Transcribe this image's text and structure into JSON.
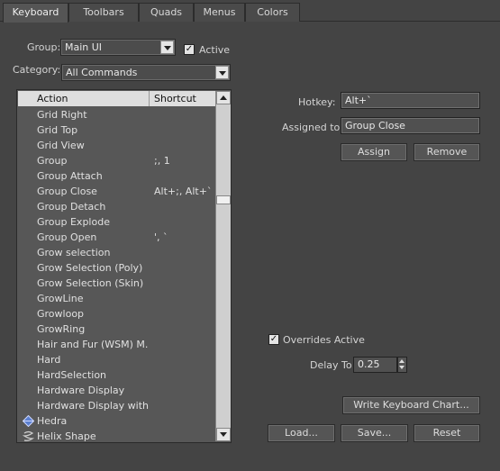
{
  "tabs": [
    {
      "label": "Keyboard",
      "active": true
    },
    {
      "label": "Toolbars",
      "active": false
    },
    {
      "label": "Quads",
      "active": false
    },
    {
      "label": "Menus",
      "active": false
    },
    {
      "label": "Colors",
      "active": false
    }
  ],
  "group": {
    "label": "Group:",
    "value": "Main UI",
    "active_label": "Active",
    "active_checked": true
  },
  "category": {
    "label": "Category:",
    "value": "All Commands"
  },
  "list": {
    "headers": {
      "action": "Action",
      "shortcut": "Shortcut"
    },
    "rows": [
      {
        "action": "Grid Right",
        "shortcut": ""
      },
      {
        "action": "Grid Top",
        "shortcut": ""
      },
      {
        "action": "Grid View",
        "shortcut": ""
      },
      {
        "action": "Group",
        "shortcut": ";, 1"
      },
      {
        "action": "Group Attach",
        "shortcut": ""
      },
      {
        "action": "Group Close",
        "shortcut": "Alt+;, Alt+`"
      },
      {
        "action": "Group Detach",
        "shortcut": ""
      },
      {
        "action": "Group Explode",
        "shortcut": ""
      },
      {
        "action": "Group Open",
        "shortcut": "', `"
      },
      {
        "action": "Grow selection",
        "shortcut": ""
      },
      {
        "action": "Grow Selection (Poly)",
        "shortcut": ""
      },
      {
        "action": "Grow Selection (Skin)",
        "shortcut": ""
      },
      {
        "action": "GrowLine",
        "shortcut": ""
      },
      {
        "action": "Growloop",
        "shortcut": ""
      },
      {
        "action": "GrowRing",
        "shortcut": ""
      },
      {
        "action": "Hair and Fur (WSM) M...",
        "shortcut": ""
      },
      {
        "action": "Hard",
        "shortcut": ""
      },
      {
        "action": "HardSelection",
        "shortcut": ""
      },
      {
        "action": "Hardware Display",
        "shortcut": ""
      },
      {
        "action": "Hardware Display with...",
        "shortcut": ""
      },
      {
        "action": "Hedra",
        "shortcut": "",
        "icon": "hedra-icon"
      },
      {
        "action": "Helix Shape",
        "shortcut": "",
        "icon": "helix-icon"
      }
    ]
  },
  "hotkey": {
    "label": "Hotkey:",
    "value": "Alt+`"
  },
  "assigned": {
    "label": "Assigned to:",
    "value": "Group Close"
  },
  "buttons": {
    "assign": "Assign",
    "remove": "Remove",
    "write_chart": "Write Keyboard Chart...",
    "load": "Load...",
    "save": "Save...",
    "reset": "Reset"
  },
  "overrides": {
    "label": "Overrides Active",
    "checked": true
  },
  "delay": {
    "label": "Delay To",
    "value": "0.25"
  },
  "colors": {
    "background": "#444444",
    "list_bg": "#575757",
    "header_bg": "#dedede"
  }
}
